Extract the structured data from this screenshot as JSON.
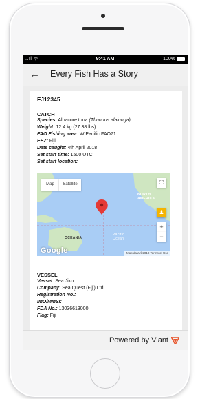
{
  "status_bar": {
    "carrier": "..ıl ᯤ",
    "time": "9:41 AM",
    "battery": "100%"
  },
  "app_bar": {
    "back_icon": "arrow-left-icon",
    "title": "Every Fish Has a Story"
  },
  "fish_id": "FJ12345",
  "catch": {
    "heading": "CATCH",
    "species_label": "Species:",
    "species_value": "Albacore tuna",
    "species_latin": "(Thunnus alalunga)",
    "weight_label": "Weight:",
    "weight_value": "12.4 kg (27.38 lbs)",
    "fao_label": "FAO Fishing area:",
    "fao_value": "W Pacific FAO71",
    "eez_label": "EEZ:",
    "eez_value": "Fiji",
    "date_label": "Date caught:",
    "date_value": "4th April 2018",
    "set_time_label": "Set start time:",
    "set_time_value": "1500 UTC",
    "set_location_label": "Set start location:"
  },
  "map": {
    "tab_map": "Map",
    "tab_satellite": "Satellite",
    "label_north_america": "NORTH\nAMERICA",
    "label_oceania": "OCEANIA",
    "label_pacific": "Pacific\nOcean",
    "google": "Google",
    "attribution": "Map data ©2018  Terms of Use",
    "zoom_in": "+",
    "zoom_out": "−",
    "colors": {
      "water": "#a9cdf5",
      "land": "#cfe6c1",
      "pin": "#e53935"
    }
  },
  "vessel": {
    "heading": "VESSEL",
    "vessel_label": "Vessel:",
    "vessel_value": "Sea Jiko",
    "company_label": "Company:",
    "company_value": "Sea Quest (Fiji) Ltd",
    "registration_label": "Registration No.:",
    "imo_label": "IMO/MMSI:",
    "fda_label": "FDA No.:",
    "fda_value": "13036613000",
    "flag_label": "Flag:",
    "flag_value": "Fiji"
  },
  "footer": {
    "powered_by": "Powered by Viant",
    "logo_color": "#e8552b"
  }
}
